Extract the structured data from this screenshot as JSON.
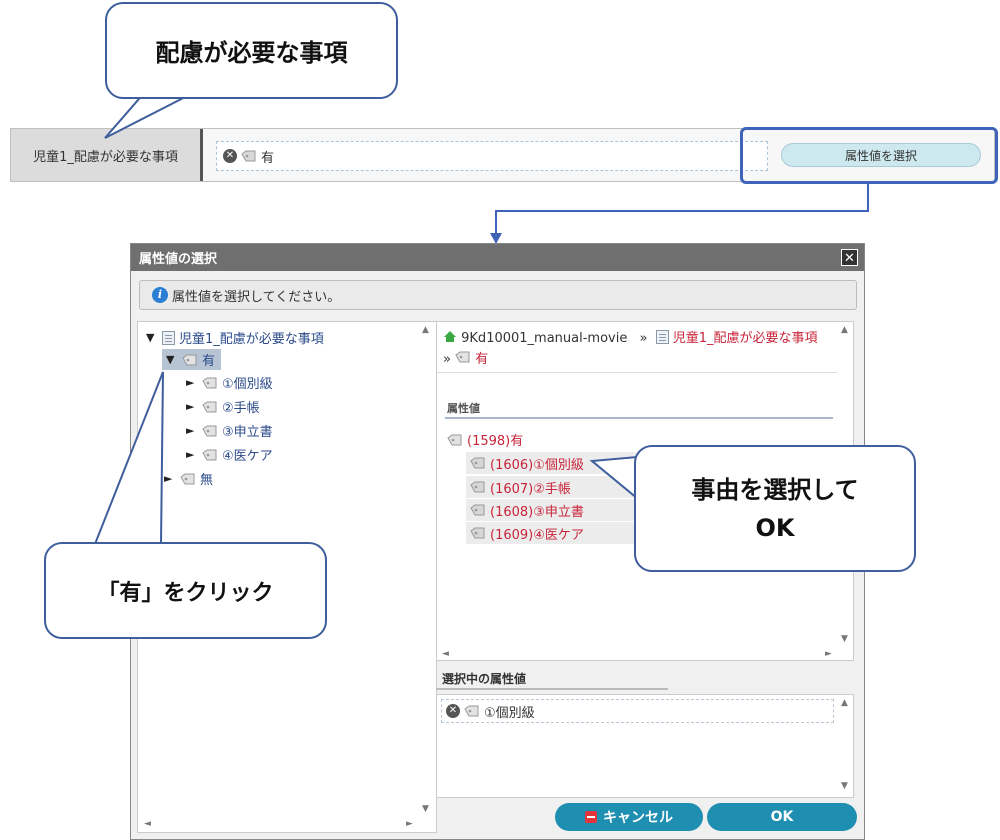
{
  "callouts": {
    "top": "配慮が必要な事項",
    "left": "「有」をクリック",
    "right_line1": "事由を選択して",
    "right_line2": "OK"
  },
  "field": {
    "label": "児童1_配慮が必要な事項",
    "value": "有",
    "select_button": "属性値を選択"
  },
  "dialog": {
    "title": "属性値の選択",
    "close": "✕",
    "info": "属性値を選択してください。",
    "tree": {
      "root": "児童1_配慮が必要な事項",
      "selected": "有",
      "children": [
        "①個別級",
        "②手帳",
        "③申立書",
        "④医ケア"
      ],
      "sibling": "無"
    },
    "breadcrumb": {
      "home": "9Kd10001_manual-movie",
      "sep": "»",
      "parent": "児童1_配慮が必要な事項",
      "current": "有"
    },
    "attr_section_label": "属性値",
    "attr_root": "(1598)有",
    "attr_items": [
      "(1606)①個別級",
      "(1607)②手帳",
      "(1608)③申立書",
      "(1609)④医ケア"
    ],
    "selected_section_label": "選択中の属性値",
    "selected_value": "①個別級",
    "cancel_button": "キャンセル",
    "ok_button": "OK"
  },
  "colors": {
    "accent_blue": "#3e5e9c",
    "button_teal": "#1f8fb1",
    "link_red": "#c8243a",
    "title_gray": "#6f6f6f"
  }
}
